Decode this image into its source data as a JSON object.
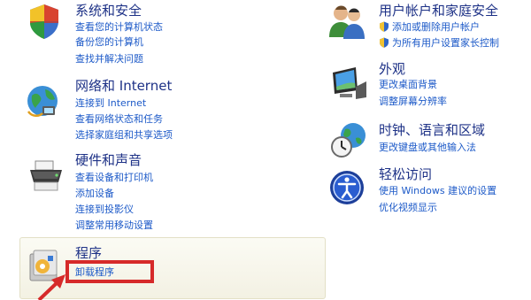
{
  "categories": {
    "system_security": {
      "title": "系统和安全",
      "links": [
        "查看您的计算机状态",
        "备份您的计算机",
        "查找并解决问题"
      ]
    },
    "network": {
      "title": "网络和 Internet",
      "links": [
        "连接到 Internet",
        "查看网络状态和任务",
        "选择家庭组和共享选项"
      ]
    },
    "hardware_sound": {
      "title": "硬件和声音",
      "links": [
        "查看设备和打印机",
        "添加设备",
        "连接到投影仪",
        "调整常用移动设置"
      ]
    },
    "programs": {
      "title": "程序",
      "links": [
        "卸载程序"
      ]
    },
    "user_accounts": {
      "title": "用户帐户和家庭安全",
      "links": [
        "添加或删除用户帐户",
        "为所有用户设置家长控制"
      ]
    },
    "appearance": {
      "title": "外观",
      "links": [
        "更改桌面背景",
        "调整屏幕分辨率"
      ]
    },
    "clock_region": {
      "title": "时钟、语言和区域",
      "links": [
        "更改键盘或其他输入法"
      ]
    },
    "ease_of_access": {
      "title": "轻松访问",
      "links": [
        "使用 Windows 建议的设置",
        "优化视频显示"
      ]
    }
  },
  "icons": {
    "system_security": "shield-icon",
    "network": "globe-network-icon",
    "hardware_sound": "printer-icon",
    "programs": "programs-icon",
    "user_accounts": "users-icon",
    "appearance": "monitor-icon",
    "clock_region": "clock-globe-icon",
    "ease_of_access": "ease-of-access-icon",
    "uac": "uac-shield-icon"
  },
  "colors": {
    "title": "#1e3287",
    "link": "#1d5ac8",
    "highlight": "#d62a2a",
    "programs_box": "#f6f4e6"
  }
}
